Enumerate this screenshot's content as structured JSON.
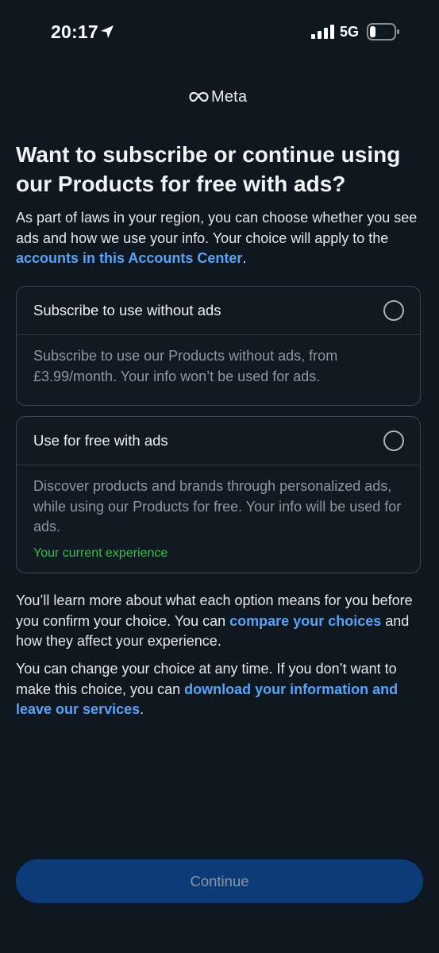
{
  "status_bar": {
    "time": "20:17",
    "network": "5G"
  },
  "brand": {
    "name": "Meta"
  },
  "title": "Want to subscribe or continue using our Products for free with ads?",
  "intro": {
    "text": "As part of laws in your region, you can choose whether you see ads and how we use your info. Your choice will apply to the ",
    "link": "accounts in this Accounts Center",
    "end": "."
  },
  "options": [
    {
      "title": "Subscribe to use without ads",
      "description": "Subscribe to use our Products without ads, from £3.99/month. Your info won’t be used for ads."
    },
    {
      "title": "Use for free with ads",
      "description": "Discover products and brands through personalized ads, while using our Products for free. Your info will be used for ads.",
      "note": "Your current experience"
    }
  ],
  "learn_more": {
    "text": "You’ll learn more about what each option means for you before you confirm your choice. You can ",
    "link": "compare your choices",
    "end": " and how they affect your experience."
  },
  "change_choice": {
    "text": "You can change your choice at any time. If you don’t want to make this choice, you can ",
    "link": "download your information and leave our services",
    "end": "."
  },
  "continue_label": "Continue",
  "colors": {
    "background": "#0f1720",
    "link": "#5ba2f5",
    "accent_green": "#3fb950",
    "button": "#0d3b78"
  }
}
